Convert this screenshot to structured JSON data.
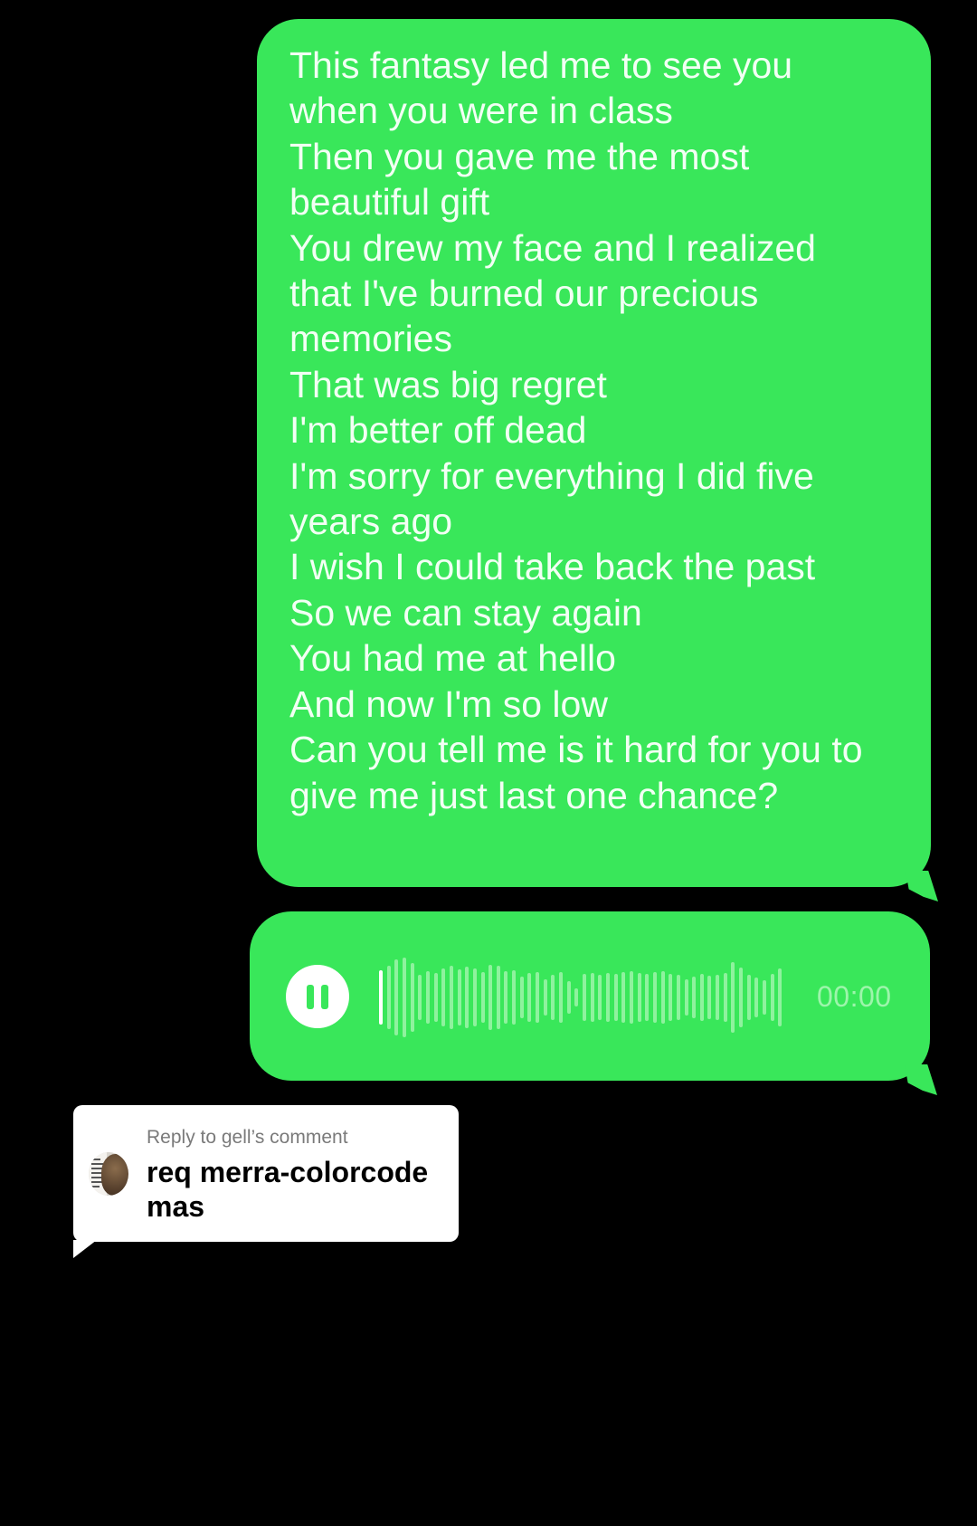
{
  "colors": {
    "background": "#000000",
    "bubble_green": "#39e75a",
    "bubble_text": "#f2fff4",
    "card_background": "#ffffff"
  },
  "lyrics_message": {
    "lines": [
      "This fantasy led me to see you",
      "when you were in class",
      "Then you gave me the most",
      "beautiful gift",
      "You drew my face and I realized",
      "that I've burned our precious",
      "memories",
      "That was big regret",
      "I'm better off dead",
      "I'm sorry for everything I did five",
      "years ago",
      "I wish I could take back the past",
      "So we can stay again",
      "You had me at hello",
      "And now I'm so low",
      "Can you tell me is it hard for you to",
      "give me just last one chance?"
    ]
  },
  "voice_message": {
    "control_icon": "pause-icon",
    "time": "00:00",
    "playback_progress": 0
  },
  "reply_card": {
    "label": "Reply to gell’s comment",
    "text": "req merra-colorcode mas"
  }
}
